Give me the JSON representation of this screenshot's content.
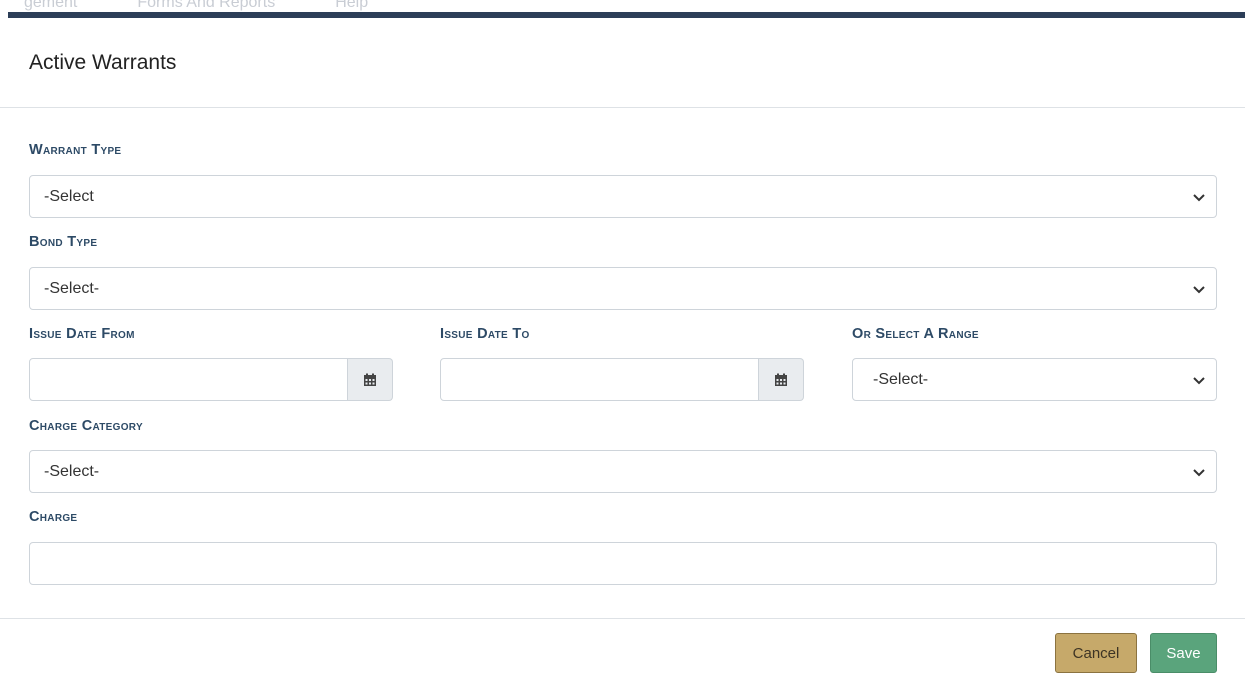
{
  "top_nav": {
    "items": [
      "gement",
      "Forms And Reports",
      "Help"
    ]
  },
  "modal": {
    "title": "Active Warrants"
  },
  "fields": {
    "warrant_type": {
      "label": "Warrant Type",
      "value": "-Select"
    },
    "bond_type": {
      "label": "Bond Type",
      "value": "-Select-"
    },
    "issue_date_from": {
      "label": "Issue Date From",
      "value": ""
    },
    "issue_date_to": {
      "label": "Issue Date To",
      "value": ""
    },
    "range": {
      "label": "Or Select A Range",
      "value": "-Select-"
    },
    "charge_category": {
      "label": "Charge Category",
      "value": "-Select-"
    },
    "charge": {
      "label": "Charge",
      "value": ""
    }
  },
  "buttons": {
    "cancel": "Cancel",
    "save": "Save"
  },
  "colors": {
    "label": "#2d4a66",
    "nav_bar": "#2c3e58",
    "cancel_bg": "#c6a96a",
    "save_bg": "#5aa47c"
  },
  "icons": {
    "select_arrow": "chevron-down-icon",
    "date_picker": "calendar-icon"
  }
}
